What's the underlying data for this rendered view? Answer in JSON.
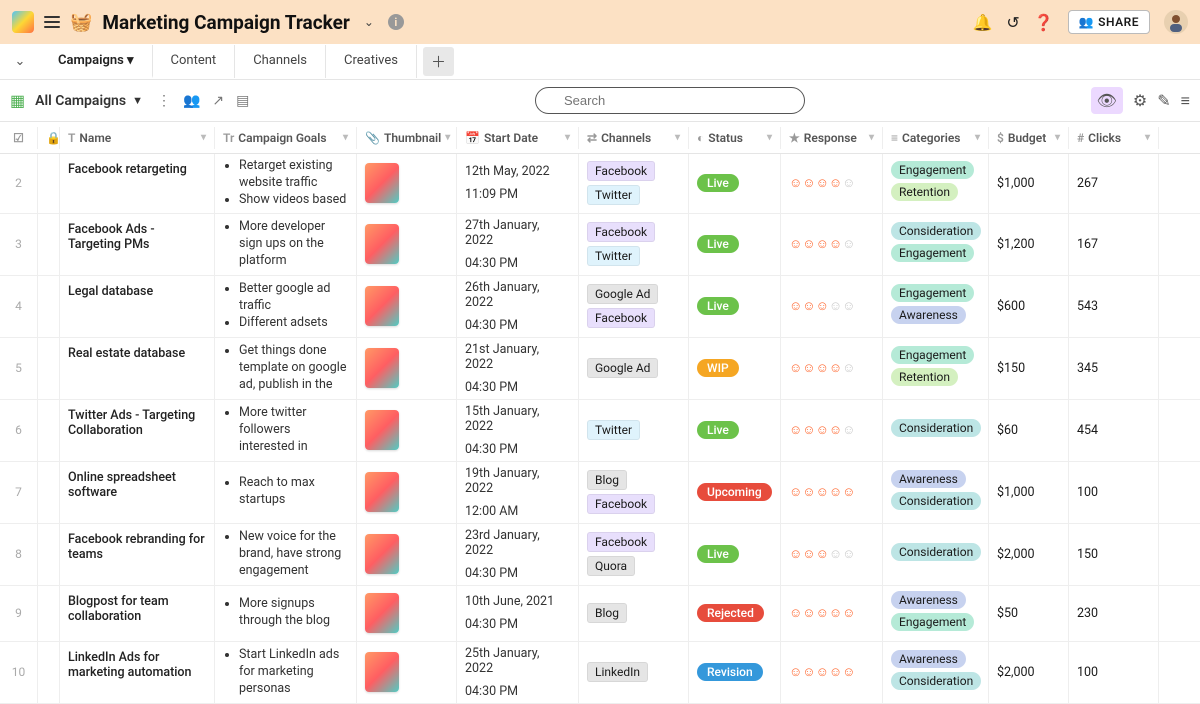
{
  "header": {
    "title": "Marketing Campaign Tracker",
    "share_label": "SHARE"
  },
  "tabs": [
    {
      "label": "Campaigns",
      "active": true,
      "dropdown": true
    },
    {
      "label": "Content",
      "active": false
    },
    {
      "label": "Channels",
      "active": false
    },
    {
      "label": "Creatives",
      "active": false
    }
  ],
  "view": {
    "name": "All Campaigns",
    "search_placeholder": "Search"
  },
  "columns": {
    "name": "Name",
    "goals": "Campaign Goals",
    "thumb": "Thumbnail",
    "date": "Start Date",
    "channels": "Channels",
    "status": "Status",
    "response": "Response",
    "categories": "Categories",
    "budget": "Budget",
    "clicks": "Clicks"
  },
  "channel_colors": {
    "Facebook": "#e8dffc",
    "Twitter": "#dff3fc",
    "Google Ad": "#e5e5e5",
    "Blog": "#e5e5e5",
    "Quora": "#e5e5e5",
    "LinkedIn": "#e5e5e5"
  },
  "status_colors": {
    "Live": "#6cc24a",
    "WIP": "#f5a623",
    "Upcoming": "#e74c3c",
    "Rejected": "#e74c3c",
    "Revision": "#3498db"
  },
  "category_colors": {
    "Engagement": "#b5ead7",
    "Retention": "#d4f0c0",
    "Consideration": "#bde5e5",
    "Awareness": "#c7d2ef"
  },
  "rows": [
    {
      "n": "2",
      "name": "Facebook retargeting",
      "goals": [
        "Retarget existing website traffic",
        "Show videos based"
      ],
      "date": "12th May, 2022",
      "time": "11:09 PM",
      "channels": [
        "Facebook",
        "Twitter"
      ],
      "status": "Live",
      "response": 4,
      "categories": [
        "Engagement",
        "Retention"
      ],
      "budget": "$1,000",
      "clicks": "267"
    },
    {
      "n": "3",
      "name": "Facebook Ads - Targeting PMs",
      "goals": [
        "More developer sign ups on the platform"
      ],
      "date": "27th January, 2022",
      "time": "04:30 PM",
      "channels": [
        "Facebook",
        "Twitter"
      ],
      "status": "Live",
      "response": 4,
      "categories": [
        "Consideration",
        "Engagement"
      ],
      "budget": "$1,200",
      "clicks": "167"
    },
    {
      "n": "4",
      "name": "Legal database",
      "goals": [
        "Better google ad traffic",
        "Different adsets"
      ],
      "date": "26th January, 2022",
      "time": "04:30 PM",
      "channels": [
        "Google Ad",
        "Facebook"
      ],
      "status": "Live",
      "response": 3,
      "categories": [
        "Engagement",
        "Awareness"
      ],
      "budget": "$600",
      "clicks": "543"
    },
    {
      "n": "5",
      "name": "Real estate database",
      "goals": [
        "Get things done template on google ad, publish in the"
      ],
      "date": "21st January, 2022",
      "time": "04:30 PM",
      "channels": [
        "Google Ad"
      ],
      "status": "WIP",
      "response": 4,
      "categories": [
        "Engagement",
        "Retention"
      ],
      "budget": "$150",
      "clicks": "345"
    },
    {
      "n": "6",
      "name": "Twitter Ads - Targeting Collaboration",
      "goals": [
        "More twitter followers interested in"
      ],
      "date": "15th January, 2022",
      "time": "04:30 PM",
      "channels": [
        "Twitter"
      ],
      "status": "Live",
      "response": 4,
      "categories": [
        "Consideration"
      ],
      "budget": "$60",
      "clicks": "454"
    },
    {
      "n": "7",
      "name": "Online spreadsheet software",
      "goals": [
        "Reach to max startups"
      ],
      "date": "19th January, 2022",
      "time": "12:00 AM",
      "channels": [
        "Blog",
        "Facebook"
      ],
      "status": "Upcoming",
      "response": 5,
      "categories": [
        "Awareness",
        "Consideration"
      ],
      "budget": "$1,000",
      "clicks": "100"
    },
    {
      "n": "8",
      "name": "Facebook rebranding for teams",
      "goals": [
        "New voice for the brand, have strong engagement"
      ],
      "date": "23rd January, 2022",
      "time": "04:30 PM",
      "channels": [
        "Facebook",
        "Quora"
      ],
      "status": "Live",
      "response": 3,
      "categories": [
        "Consideration"
      ],
      "budget": "$2,000",
      "clicks": "150"
    },
    {
      "n": "9",
      "name": "Blogpost for team collaboration",
      "goals": [
        "More signups through the blog"
      ],
      "date": "10th June, 2021",
      "time": "04:30 PM",
      "channels": [
        "Blog"
      ],
      "status": "Rejected",
      "response": 5,
      "categories": [
        "Awareness",
        "Engagement"
      ],
      "budget": "$50",
      "clicks": "230"
    },
    {
      "n": "10",
      "name": "LinkedIn Ads for marketing automation",
      "goals": [
        "Start LinkedIn ads for marketing personas"
      ],
      "date": "25th January, 2022",
      "time": "04:30 PM",
      "channels": [
        "LinkedIn"
      ],
      "status": "Revision",
      "response": 5,
      "categories": [
        "Awareness",
        "Consideration"
      ],
      "budget": "$2,000",
      "clicks": "100"
    }
  ]
}
